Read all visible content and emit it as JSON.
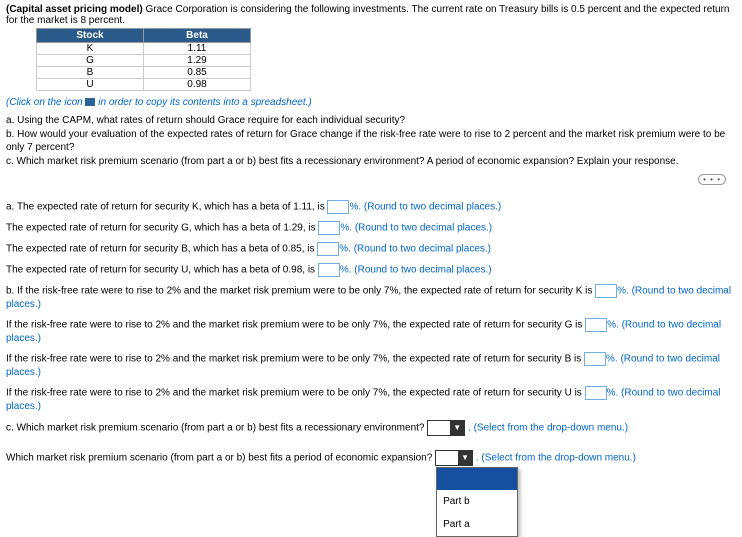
{
  "title": "(Capital asset pricing model)",
  "intro": "Grace Corporation is considering the following investments. The current rate on Treasury bills is 0.5 percent and the expected return for the market is 8 percent.",
  "table": {
    "headers": [
      "Stock",
      "Beta"
    ],
    "rows": [
      [
        "K",
        "1.11"
      ],
      [
        "G",
        "1.29"
      ],
      [
        "B",
        "0.85"
      ],
      [
        "U",
        "0.98"
      ]
    ]
  },
  "clickNote_pre": "(Click on the icon ",
  "clickNote_post": " in order to copy its contents into a spreadsheet.)",
  "q_a": "a. Using the CAPM, what rates of return should Grace require for each individual security?",
  "q_b": "b. How would your evaluation of the expected rates of return for Grace change if the risk-free rate were to rise to 2 percent and the market risk premium were to be only 7 percent?",
  "q_c": "c. Which market risk premium scenario (from part a or b) best fits a recessionary environment? A period of economic expansion? Explain your response.",
  "ans": {
    "aK_pre": "a. The expected rate of return for security K, which has a beta of 1.11, is ",
    "aG_pre": "The expected rate of return for security G, which has a beta of 1.29, is ",
    "aB_pre": "The expected rate of return for security B, which has a beta of 0.85, is ",
    "aU_pre": "The expected rate of return for security U, which has a beta of 0.98, is ",
    "bK_pre": "b. If the risk-free rate were to rise to 2% and the market risk premium were to be only 7%, the expected rate of return for security K is ",
    "bG_pre": "If the risk-free rate were to rise to 2% and the market risk premium were to be only 7%, the expected rate of return for security G is ",
    "bB_pre": "If the risk-free rate were to rise to 2% and the market risk premium were to be only 7%, the expected rate of return for security B is ",
    "bU_pre": "If the risk-free rate were to rise to 2% and the market risk premium were to be only 7%, the expected rate of return for security U is ",
    "c1_pre": "c. Which market risk premium scenario (from part a or b) best fits a recessionary environment? ",
    "c2_pre": "Which market risk premium scenario (from part a or b) best fits a period of economic expansion? ",
    "pct_hint": "%. (Round to two decimal places.)",
    "dd_hint": ". (Select from the drop-down menu.)"
  },
  "dropdown": {
    "opts": [
      "",
      "Part b",
      "Part a"
    ]
  }
}
